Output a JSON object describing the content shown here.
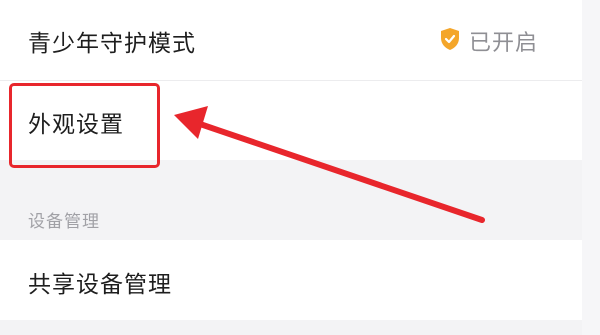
{
  "settings": {
    "rows": [
      {
        "label": "青少年守护模式",
        "status": "已开启",
        "status_icon": "shield-check-icon"
      },
      {
        "label": "外观设置"
      }
    ],
    "section": {
      "title": "设备管理",
      "items": [
        {
          "label": "共享设备管理"
        }
      ]
    }
  },
  "colors": {
    "background": "#f3f3f5",
    "panel": "#ffffff",
    "text_primary": "#1e1e1e",
    "text_secondary": "#8f8f94",
    "shield_orange": "#f4a62a",
    "annotation_red": "#e8262c"
  }
}
